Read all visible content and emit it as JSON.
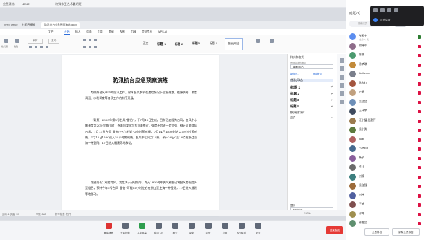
{
  "meeting": {
    "title": "应急演练",
    "time": "15:16",
    "subtitle": "特殊卡王艺术暑期班",
    "participants_label": "成员(72)",
    "search_placeholder": "搜索成员",
    "invite_btn": "邀请"
  },
  "wps": {
    "tabs": [
      "WPS Office",
      "找稻壳模板",
      "防汛抗台应急预案演练.docx"
    ],
    "menu": [
      "文件",
      "开始",
      "插入",
      "页面",
      "引用",
      "审阅",
      "视图",
      "工具",
      "会员专享",
      "WPS AI"
    ],
    "active_menu": "开始",
    "ribbon_labels": [
      "格式刷",
      "粘贴",
      "宋体",
      "五号"
    ],
    "styles": [
      "正文",
      "标题 1",
      "标题 2",
      "标题 3",
      "标题 4",
      "普通(网站)"
    ],
    "selected_style": "普通(网站)"
  },
  "document": {
    "title": "防汛抗台应急预案演练",
    "p1": "为做好台风季节的防汛工作，保障台风季节在遇险情况下应急疏散、能源供给、粮食调运、水利调度等各项工作的有序开展。",
    "p2_lead": "（背景）2025年第5号台风“雷伯”，于7月12日生成。目前已加强为台风，台风中心移速度为20公里每小时，逐渐向我国华东沿海靠近，强度还会进一步加强，预计可能登陆台风，7月13日台风“雷伯”中心附近72小时警戒线，7月14日1500时进入48小时警戒线，7月15日1500进入24小时警戒线，台风中心风力14级，预计16日0至10点在浙江沿海一带登陆，17日进入福建等地移动。",
    "p3": "徐副局长：观看得好，我是大于分站领导。今天1800时中央气象台已将台风警报提升至橙色，预计今年5号台风“雷伯”可能24小时左右在浙江至上海一带登陆，17日进入福建等地移动。"
  },
  "style_pane": {
    "title": "样式和格式",
    "current_label": "所选文字的格式",
    "current": "普通(网站)",
    "new_style": "新样式...",
    "clear": "清除格式",
    "list": [
      "普通(网站)",
      "标题 1",
      "标题 2",
      "标题 3",
      "标题 4",
      "默认段落字体",
      "正文"
    ],
    "show_label": "显示",
    "show_value": "有效样式"
  },
  "statusbar": {
    "page": "页码: 1  页面: 1/3",
    "words": "字数: 862",
    "spell": "拼写检查: 打开",
    "zoom": "100%"
  },
  "toolbar": {
    "items": [
      "解除静音",
      "开启视频",
      "共享屏幕",
      "成员(72)",
      "聊天",
      "录制",
      "表情",
      "应用",
      "AI小助手",
      "更多"
    ],
    "end": "结束会议"
  },
  "participants": [
    {
      "name": "张天宇",
      "sub": "(主持人, 我)",
      "color": "#5b8def",
      "mic": "on"
    },
    {
      "name": "何伟军",
      "sub": "",
      "color": "#8e6c8a",
      "mic": "off"
    },
    {
      "name": "陈静",
      "sub": "",
      "color": "#4c9a6f",
      "mic": "off"
    },
    {
      "name": "徐梦琪",
      "sub": "",
      "color": "#c28a3a",
      "mic": "off"
    },
    {
      "name": "Katherine",
      "sub": "",
      "color": "#7a7f8c",
      "mic": "off"
    },
    {
      "name": "陈志红",
      "sub": "",
      "color": "#a3553f",
      "mic": "off"
    },
    {
      "name": "卢娟",
      "sub": "",
      "color": "#c0a07f",
      "mic": "off"
    },
    {
      "name": "吴佳音",
      "sub": "",
      "color": "#6d8fb8",
      "mic": "off"
    },
    {
      "name": "王环宇",
      "sub": "",
      "color": "#3f4b5e",
      "mic": "off"
    },
    {
      "name": "汪小猛 吴建平",
      "sub": "",
      "color": "#9b7b4f",
      "mic": "off"
    },
    {
      "name": "吴小勇",
      "sub": "",
      "color": "#5d7a3e",
      "mic": "off"
    },
    {
      "name": "yuan",
      "sub": "",
      "color": "#b06060",
      "mic": "off"
    },
    {
      "name": "YOKER",
      "sub": "",
      "color": "#476a8f",
      "mic": "off"
    },
    {
      "name": "杨子",
      "sub": "",
      "color": "#8a5f9c",
      "mic": "off"
    },
    {
      "name": "蒋乃",
      "sub": "",
      "color": "#6b6b6b",
      "mic": "off"
    },
    {
      "name": "刘毅",
      "sub": "",
      "color": "#3d7f7f",
      "mic": "off"
    },
    {
      "name": "吴自强",
      "sub": "",
      "color": "#9c6b3a",
      "mic": "off"
    },
    {
      "name": "刘伟",
      "sub": "",
      "color": "#4f5f9f",
      "mic": "off"
    },
    {
      "name": "王新",
      "sub": "",
      "color": "#7f4f4f",
      "mic": "off"
    },
    {
      "name": "邓梅",
      "sub": "",
      "color": "#9f8f4f",
      "mic": "off"
    },
    {
      "name": "徐雪兰",
      "sub": "",
      "color": "#5f8f6f",
      "mic": "off"
    }
  ],
  "panel_buttons": [
    "全员静音",
    "解除全员静音"
  ],
  "popup": {
    "text": "正在讲话"
  }
}
